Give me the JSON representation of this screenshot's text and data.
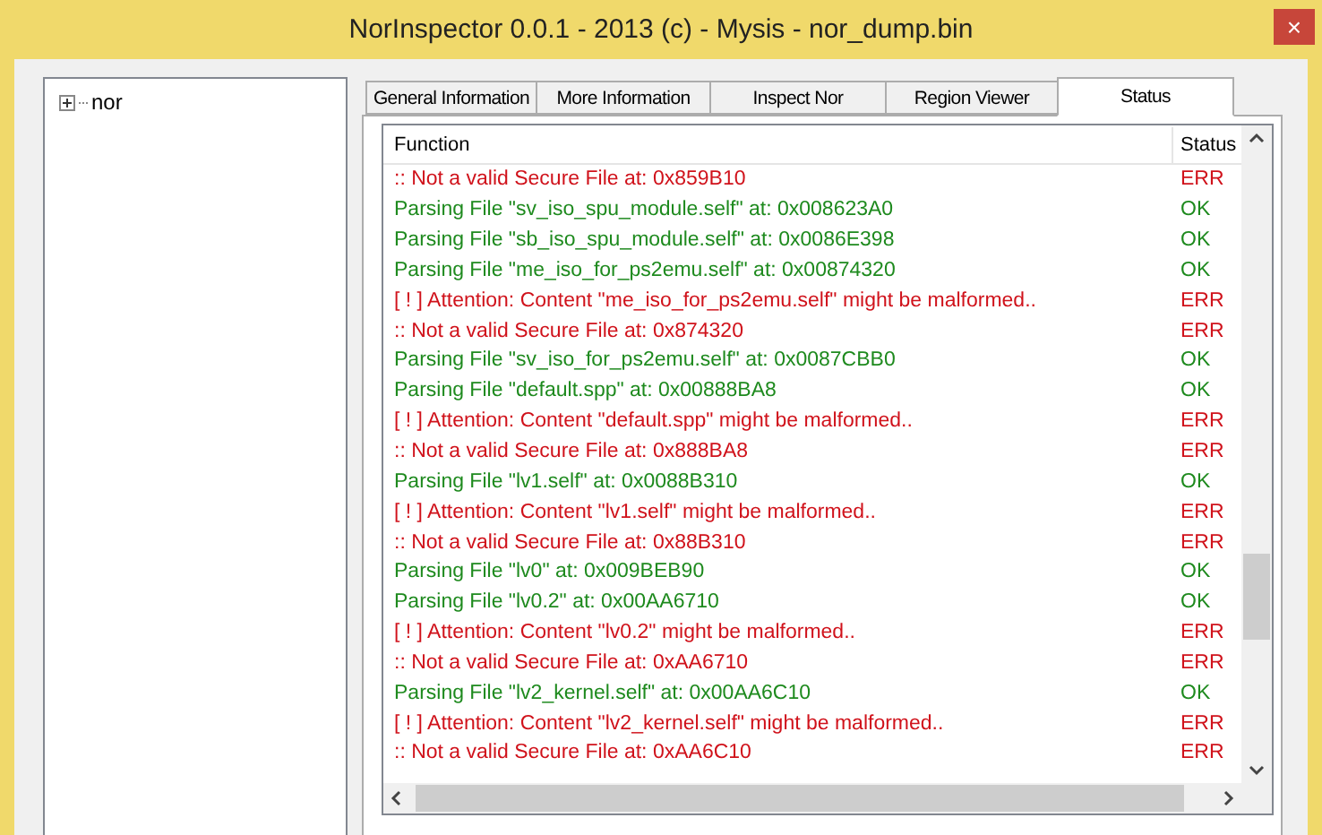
{
  "window": {
    "title": "NorInspector 0.0.1 - 2013 (c) - Mysis - nor_dump.bin",
    "close": "×"
  },
  "tree": {
    "items": [
      {
        "label": "nor",
        "expanded": false
      }
    ]
  },
  "tabs": [
    {
      "label": "General Information",
      "selected": false
    },
    {
      "label": "More Information",
      "selected": false
    },
    {
      "label": "Inspect Nor",
      "selected": false
    },
    {
      "label": "Region Viewer",
      "selected": false
    },
    {
      "label": "Status",
      "selected": true
    }
  ],
  "table": {
    "columns": [
      "Function",
      "Status"
    ],
    "rows": [
      {
        "kind": "err",
        "function": ":: Not a valid Secure File at: 0x859B10",
        "status": "ERR"
      },
      {
        "kind": "ok",
        "function": "Parsing File \"sv_iso_spu_module.self\" at: 0x008623A0",
        "status": "OK"
      },
      {
        "kind": "ok",
        "function": "Parsing File \"sb_iso_spu_module.self\" at: 0x0086E398",
        "status": "OK"
      },
      {
        "kind": "ok",
        "function": "Parsing File \"me_iso_for_ps2emu.self\" at: 0x00874320",
        "status": "OK"
      },
      {
        "kind": "err",
        "function": "[ ! ] Attention: Content \"me_iso_for_ps2emu.self\" might be malformed..",
        "status": "ERR"
      },
      {
        "kind": "err",
        "function": ":: Not a valid Secure File at: 0x874320",
        "status": "ERR"
      },
      {
        "kind": "ok",
        "function": "Parsing File \"sv_iso_for_ps2emu.self\" at: 0x0087CBB0",
        "status": "OK"
      },
      {
        "kind": "ok",
        "function": "Parsing File \"default.spp\" at: 0x00888BA8",
        "status": "OK"
      },
      {
        "kind": "err",
        "function": "[ ! ] Attention: Content \"default.spp\" might be malformed..",
        "status": "ERR"
      },
      {
        "kind": "err",
        "function": ":: Not a valid Secure File at: 0x888BA8",
        "status": "ERR"
      },
      {
        "kind": "ok",
        "function": "Parsing File \"lv1.self\" at: 0x0088B310",
        "status": "OK"
      },
      {
        "kind": "err",
        "function": "[ ! ] Attention: Content \"lv1.self\" might be malformed..",
        "status": "ERR"
      },
      {
        "kind": "err",
        "function": ":: Not a valid Secure File at: 0x88B310",
        "status": "ERR"
      },
      {
        "kind": "ok",
        "function": "Parsing File \"lv0\" at: 0x009BEB90",
        "status": "OK"
      },
      {
        "kind": "ok",
        "function": "Parsing File \"lv0.2\" at: 0x00AA6710",
        "status": "OK"
      },
      {
        "kind": "err",
        "function": "[ ! ] Attention: Content \"lv0.2\" might be malformed..",
        "status": "ERR"
      },
      {
        "kind": "err",
        "function": ":: Not a valid Secure File at: 0xAA6710",
        "status": "ERR"
      },
      {
        "kind": "ok",
        "function": "Parsing File \"lv2_kernel.self\" at: 0x00AA6C10",
        "status": "OK"
      },
      {
        "kind": "err",
        "function": "[ ! ] Attention: Content \"lv2_kernel.self\" might be malformed..",
        "status": "ERR"
      },
      {
        "kind": "err",
        "function": ":: Not a valid Secure File at: 0xAA6C10",
        "status": "ERR"
      }
    ]
  }
}
